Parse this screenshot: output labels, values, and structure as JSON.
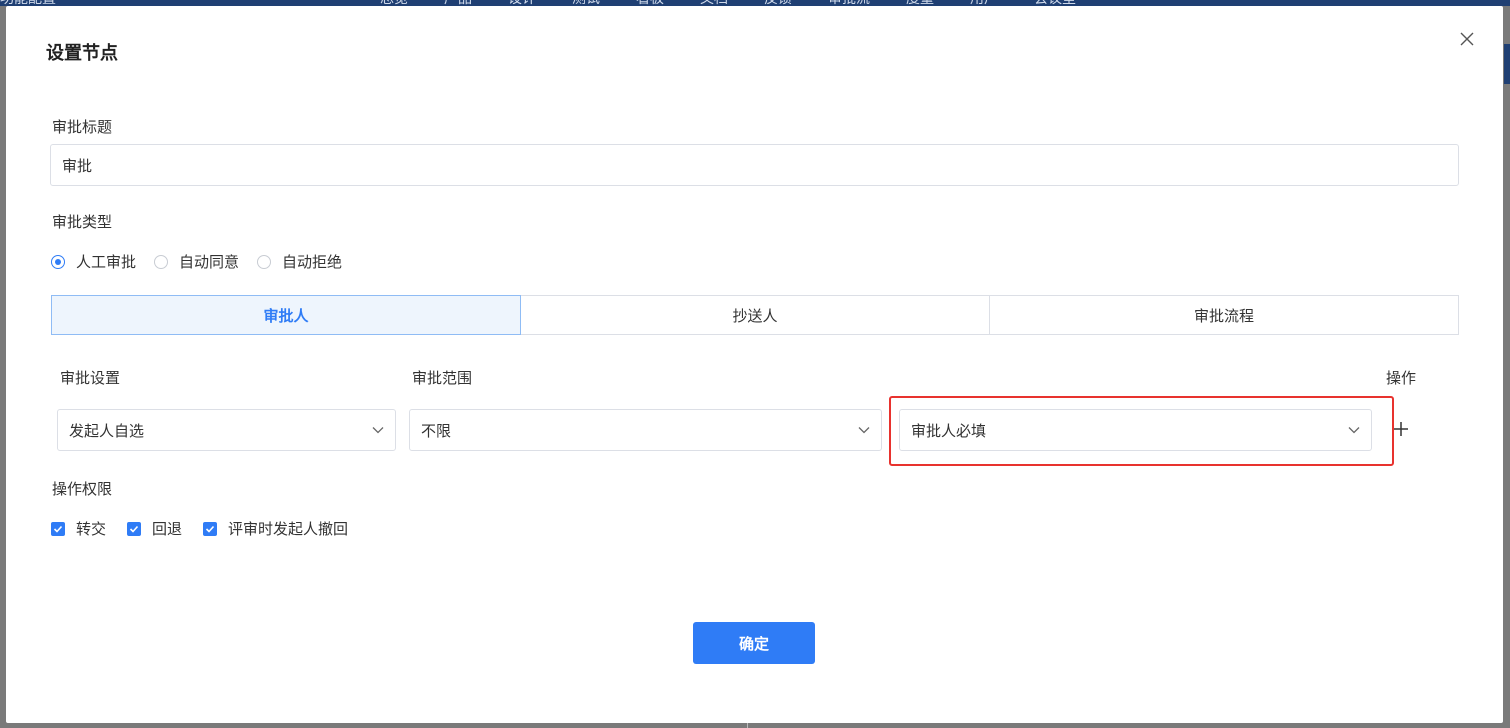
{
  "background": {
    "app_title": "功能配置",
    "nav_links": [
      "总览",
      "产品",
      "设计",
      "测试",
      "看板",
      "文档",
      "反馈",
      "审批流",
      "度量",
      "用户",
      "会议室"
    ]
  },
  "dialog": {
    "title": "设置节点",
    "close_icon": "close-icon",
    "approval_title": {
      "label": "审批标题",
      "value": "审批"
    },
    "approval_type": {
      "label": "审批类型",
      "options": [
        {
          "label": "人工审批",
          "selected": true
        },
        {
          "label": "自动同意",
          "selected": false
        },
        {
          "label": "自动拒绝",
          "selected": false
        }
      ]
    },
    "tabs": [
      {
        "label": "审批人",
        "active": true
      },
      {
        "label": "抄送人",
        "active": false
      },
      {
        "label": "审批流程",
        "active": false
      }
    ],
    "columns": {
      "setting": "审批设置",
      "scope": "审批范围",
      "operation": "操作"
    },
    "selects": {
      "setting": "发起人自选",
      "scope": "不限",
      "requirement": "审批人必填"
    },
    "permissions": {
      "label": "操作权限",
      "items": [
        {
          "label": "转交",
          "checked": true
        },
        {
          "label": "回退",
          "checked": true
        },
        {
          "label": "评审时发起人撤回",
          "checked": true
        }
      ]
    },
    "confirm_label": "确定"
  },
  "colors": {
    "accent": "#2f7cf6",
    "highlight": "#e8322e",
    "tab_active_bg": "#eef5fd"
  }
}
